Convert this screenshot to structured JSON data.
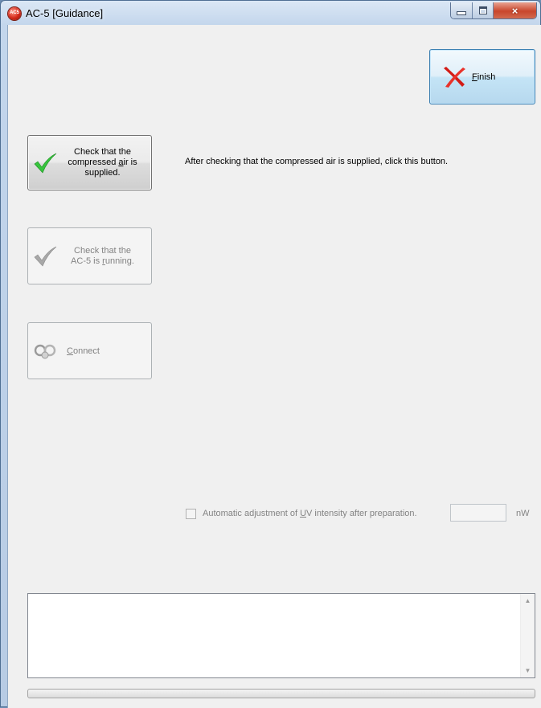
{
  "window": {
    "title": "AC-5 [Guidance]",
    "icon_text": "AC5"
  },
  "caption_buttons": {
    "minimize": "minimize-icon",
    "maximize": "maximize-icon",
    "close": "×"
  },
  "finish_button": {
    "label_hotkey": "F",
    "label_rest": "inish",
    "icon": "red-x-icon"
  },
  "steps": [
    {
      "line1": "Check that the",
      "line2_pre": "compressed ",
      "line2_hotkey": "a",
      "line2_post": "ir is",
      "line3": "supplied.",
      "icon": "green-check-icon",
      "enabled": true
    },
    {
      "line1": "Check that the",
      "line2_pre": "AC-5 is ",
      "line2_hotkey": "r",
      "line2_post": "unning.",
      "icon": "gray-check-icon",
      "enabled": false
    },
    {
      "label_hotkey": "C",
      "label_rest": "onnect",
      "icon": "connect-icon",
      "enabled": false
    }
  ],
  "instruction_text": "After checking that the compressed air is supplied, click this button.",
  "uv_option": {
    "label_pre": "Automatic adjustment of ",
    "label_hotkey": "U",
    "label_post": "V intensity after preparation.",
    "checked": false,
    "value": "",
    "unit": "nW"
  },
  "log": {
    "text": ""
  },
  "progress": {
    "value": 0
  },
  "colors": {
    "check_green": "#37c43d",
    "finish_red": "#e0221b",
    "disabled_text": "#838383"
  }
}
